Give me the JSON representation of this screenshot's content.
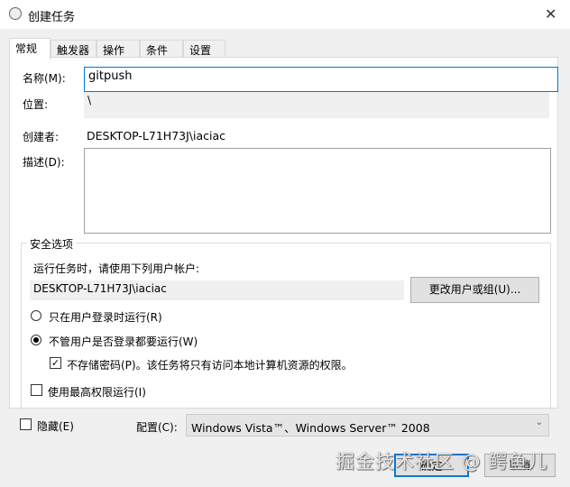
{
  "window": {
    "title": "创建任务",
    "close": "✕"
  },
  "tabs": [
    "常规",
    "触发器",
    "操作",
    "条件",
    "设置"
  ],
  "general": {
    "name_label": "名称(M):",
    "name_value": "gitpush",
    "location_label": "位置:",
    "location_value": "\\",
    "author_label": "创建者:",
    "author_value": "DESKTOP-L71H73J\\iaciac",
    "description_label": "描述(D):",
    "description_value": ""
  },
  "security": {
    "title": "安全选项",
    "run_as_label": "运行任务时，请使用下列用户帐户:",
    "user_account": "DESKTOP-L71H73J\\iaciac",
    "change_user_button": "更改用户或组(U)...",
    "radio_logged_on": "只在用户登录时运行(R)",
    "radio_whether": "不管用户是否登录都要运行(W)",
    "selected_radio": "radio_whether",
    "no_store_password": "不存储密码(P)。该任务将只有访问本地计算机资源的权限。",
    "no_store_password_checked": true,
    "highest_privileges": "使用最高权限运行(I)",
    "highest_privileges_checked": false
  },
  "hidden_label": "隐藏(E)",
  "hidden_checked": false,
  "config_label": "配置(C):",
  "config_value": "Windows Vista™、Windows Server™ 2008",
  "ok_button": "确定",
  "cancel_button": "取消",
  "watermark": "掘金技术社区 @ 鳄鱼儿"
}
